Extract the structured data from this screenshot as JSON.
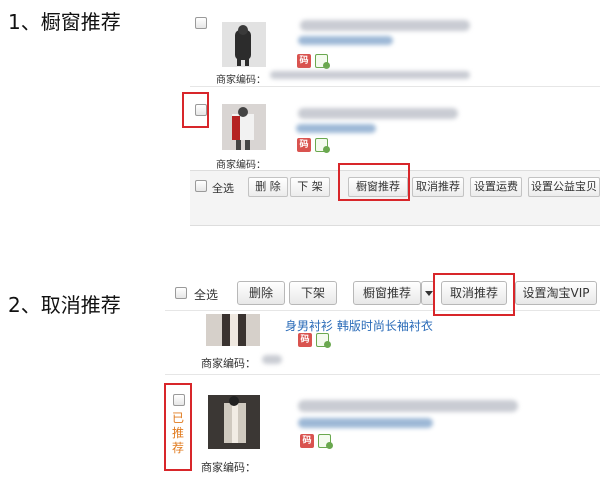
{
  "sections": [
    {
      "title": "1、橱窗推荐"
    },
    {
      "title": "2、取消推荐"
    }
  ],
  "panel1": {
    "merchant_label": "商家编码：",
    "code_badge": "码",
    "toolbar": {
      "select_all": "全选",
      "delete": "删 除",
      "delist": "下 架",
      "window_recommend": "橱窗推荐",
      "cancel_recommend": "取消推荐",
      "set_shipping": "设置运费",
      "set_charity": "设置公益宝贝"
    }
  },
  "panel2": {
    "toolbar": {
      "select_all": "全选",
      "delete": "删除",
      "delist": "下架",
      "window_recommend": "橱窗推荐",
      "cancel_recommend": "取消推荐",
      "set_vip": "设置淘宝VIP"
    },
    "item1": {
      "title": "身男衬衫 韩版时尚长袖衬衣"
    },
    "merchant_label": "商家编码：",
    "code_badge": "码",
    "recommended_badge": "已推荐"
  }
}
